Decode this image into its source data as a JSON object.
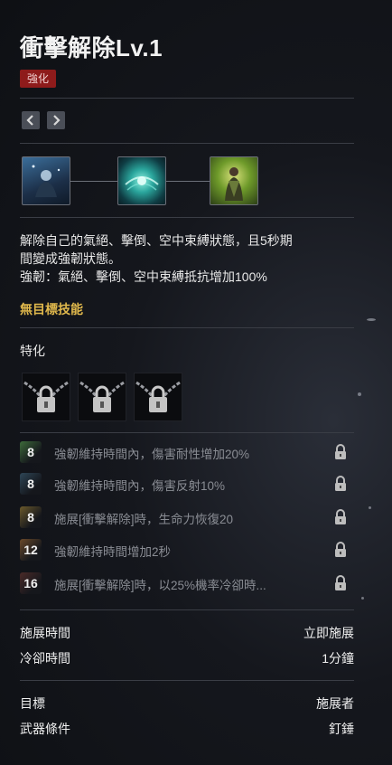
{
  "skill": {
    "title": "衝擊解除Lv.1",
    "badge": "強化",
    "description_line1": "解除自己的氣絕、擊倒、空中束縛狀態，且5秒期",
    "description_line2": "間變成強韌狀態。",
    "description_line3": "強韌：氣絕、擊倒、空中束縛抵抗增加100%",
    "target_note": "無目標技能"
  },
  "icons": {
    "prev": "chevron-left-icon",
    "next": "chevron-right-icon",
    "stage1": "meditating-figure-icon",
    "stage2": "energy-burst-icon",
    "stage3": "glowing-figure-icon",
    "locked_slot": "padlock-chain-icon",
    "row_lock": "padlock-icon"
  },
  "traits": {
    "label": "特化",
    "rows": [
      {
        "level": "8",
        "text": "強韌維持時間內，傷害耐性增加20%",
        "color": "#3d6b3a"
      },
      {
        "level": "8",
        "text": "強韌維持時間內，傷害反射10%",
        "color": "#2e4657"
      },
      {
        "level": "8",
        "text": "施展[衝擊解除]時，生命力恢復20",
        "color": "#6b5a2c"
      },
      {
        "level": "12",
        "text": "強韌維持時間增加2秒",
        "color": "#6b4a2a"
      },
      {
        "level": "16",
        "text": "施展[衝擊解除]時，以25%機率冷卻時...",
        "color": "#4a2a28"
      }
    ]
  },
  "info": {
    "cast_time_label": "施展時間",
    "cast_time_value": "立即施展",
    "cooldown_label": "冷卻時間",
    "cooldown_value": "1分鐘",
    "target_label": "目標",
    "target_value": "施展者",
    "weapon_label": "武器條件",
    "weapon_value": "釘錘"
  }
}
